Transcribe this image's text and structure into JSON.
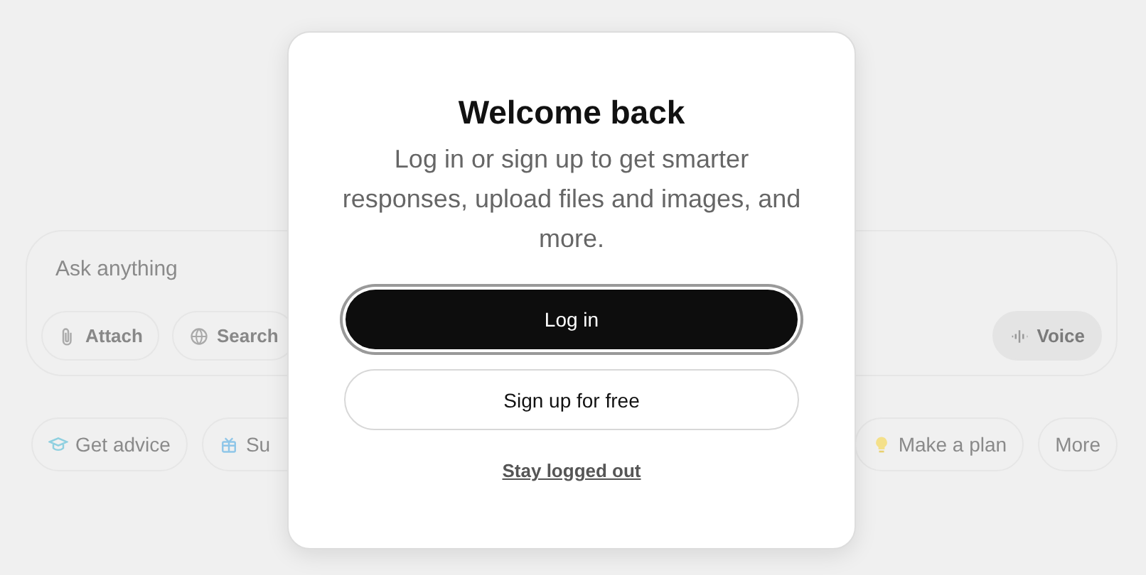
{
  "composer": {
    "placeholder": "Ask anything",
    "tools": [
      {
        "label": "Attach"
      },
      {
        "label": "Search"
      }
    ],
    "voice": {
      "label": "Voice"
    }
  },
  "suggestions": [
    {
      "label": "Get advice"
    },
    {
      "label": "Su"
    },
    {
      "label": "Make a plan"
    },
    {
      "label": "More"
    }
  ],
  "dialog": {
    "title": "Welcome back",
    "message": "Log in or sign up to get smarter responses, upload files and images, and more.",
    "primary": "Log in",
    "secondary": "Sign up for free",
    "link": "Stay logged out"
  }
}
